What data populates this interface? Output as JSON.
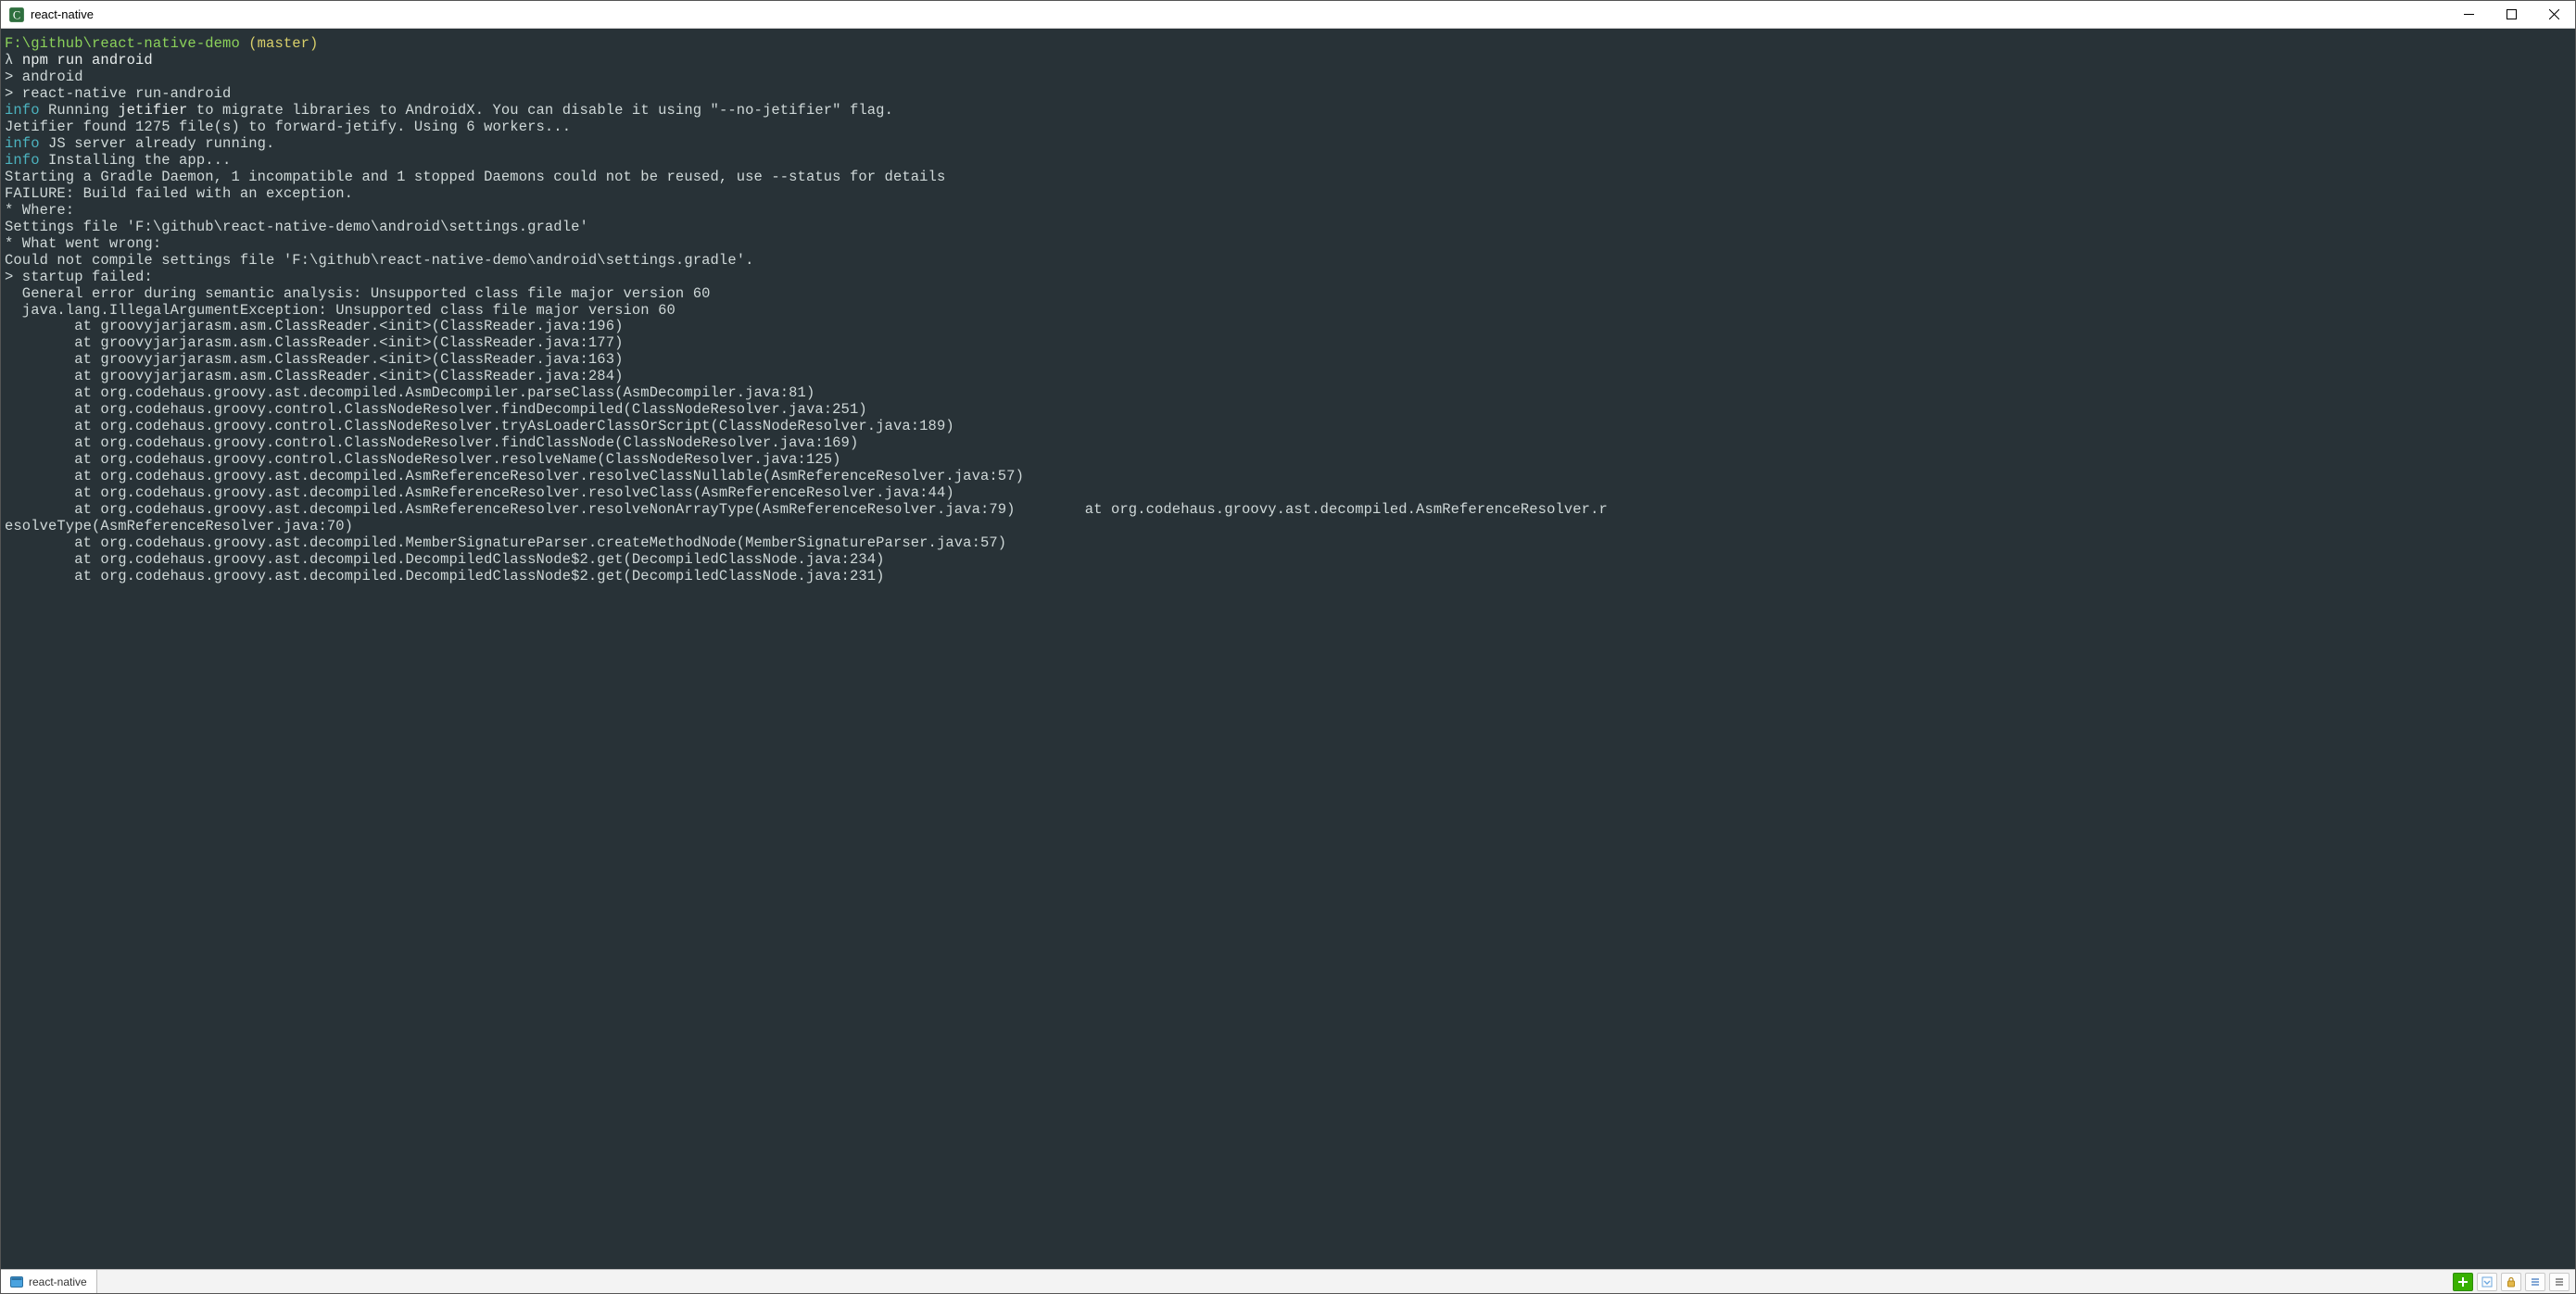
{
  "window": {
    "title": "react-native"
  },
  "prompt": {
    "path": "F:\\github\\react-native-demo",
    "branch": "(master)",
    "lambda": "λ",
    "command": "npm run android"
  },
  "script_echo": {
    "l1": "> android",
    "l2": "> react-native run-android"
  },
  "log": {
    "info_label": "info",
    "l1_a": " Running ",
    "l1_jet": "jetifier",
    "l1_b": " to migrate libraries to AndroidX. You can disable it using \"--no-jetifier\" flag.",
    "l2": "Jetifier found 1275 file(s) to forward-jetify. Using 6 workers...",
    "l3": " JS server already running.",
    "l4": " Installing the app...",
    "l5": "Starting a Gradle Daemon, 1 incompatible and 1 stopped Daemons could not be reused, use --status for details",
    "blank": "",
    "fail": "FAILURE: Build failed with an exception.",
    "where_h": "* Where:",
    "where_b": "Settings file 'F:\\github\\react-native-demo\\android\\settings.gradle'",
    "wrong_h": "* What went wrong:",
    "wrong_b": "Could not compile settings file 'F:\\github\\react-native-demo\\android\\settings.gradle'.",
    "startup": "> startup failed:",
    "general": "  General error during semantic analysis: Unsupported class file major version 60",
    "exc": "  java.lang.IllegalArgumentException: Unsupported class file major version 60",
    "st1": "        at groovyjarjarasm.asm.ClassReader.<init>(ClassReader.java:196)",
    "st2": "        at groovyjarjarasm.asm.ClassReader.<init>(ClassReader.java:177)",
    "st3": "        at groovyjarjarasm.asm.ClassReader.<init>(ClassReader.java:163)",
    "st4": "        at groovyjarjarasm.asm.ClassReader.<init>(ClassReader.java:284)",
    "st5": "        at org.codehaus.groovy.ast.decompiled.AsmDecompiler.parseClass(AsmDecompiler.java:81)",
    "st6": "        at org.codehaus.groovy.control.ClassNodeResolver.findDecompiled(ClassNodeResolver.java:251)",
    "st7": "        at org.codehaus.groovy.control.ClassNodeResolver.tryAsLoaderClassOrScript(ClassNodeResolver.java:189)",
    "st8": "        at org.codehaus.groovy.control.ClassNodeResolver.findClassNode(ClassNodeResolver.java:169)",
    "st9": "        at org.codehaus.groovy.control.ClassNodeResolver.resolveName(ClassNodeResolver.java:125)",
    "st10": "        at org.codehaus.groovy.ast.decompiled.AsmReferenceResolver.resolveClassNullable(AsmReferenceResolver.java:57)",
    "st11": "        at org.codehaus.groovy.ast.decompiled.AsmReferenceResolver.resolveClass(AsmReferenceResolver.java:44)",
    "st12": "        at org.codehaus.groovy.ast.decompiled.AsmReferenceResolver.resolveNonArrayType(AsmReferenceResolver.java:79)        at org.codehaus.groovy.ast.decompiled.AsmReferenceResolver.r",
    "st12b": "esolveType(AsmReferenceResolver.java:70)",
    "st13": "        at org.codehaus.groovy.ast.decompiled.MemberSignatureParser.createMethodNode(MemberSignatureParser.java:57)",
    "st14": "        at org.codehaus.groovy.ast.decompiled.DecompiledClassNode$2.get(DecompiledClassNode.java:234)",
    "st15": "        at org.codehaus.groovy.ast.decompiled.DecompiledClassNode$2.get(DecompiledClassNode.java:231)"
  },
  "statusbar": {
    "tab_label": "react-native"
  }
}
